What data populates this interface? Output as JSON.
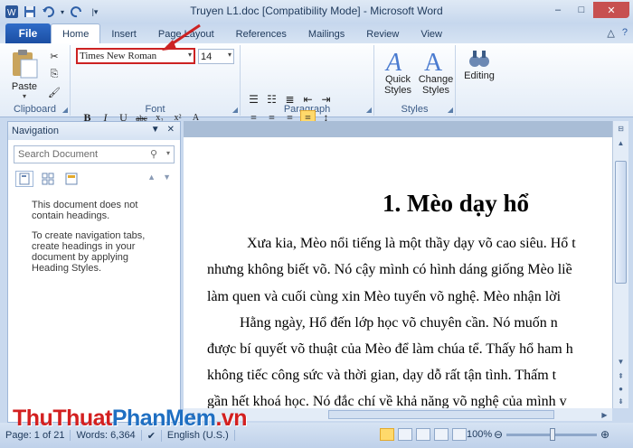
{
  "window": {
    "title": "Truyen L1.doc [Compatibility Mode] - Microsoft Word",
    "controls": {
      "minimize": "–",
      "maximize": "□",
      "close": "✕"
    }
  },
  "tabs": {
    "file": "File",
    "items": [
      "Home",
      "Insert",
      "Page Layout",
      "References",
      "Mailings",
      "Review",
      "View"
    ],
    "active": "Home"
  },
  "ribbon": {
    "clipboard": {
      "paste_label": "Paste",
      "group_label": "Clipboard"
    },
    "font": {
      "font_name": "Times New Roman",
      "font_size": "14",
      "group_label": "Font",
      "bold": "B",
      "italic": "I",
      "underline": "U",
      "strike": "abc",
      "subscript": "x₂",
      "superscript": "x²",
      "grow": "A",
      "shrink": "A",
      "change_case": "Aa",
      "clear": "A"
    },
    "paragraph": {
      "group_label": "Paragraph",
      "show_marks": "¶"
    },
    "styles": {
      "quick_styles": "Quick Styles",
      "change_styles": "Change Styles",
      "group_label": "Styles"
    },
    "editing": {
      "label": "Editing"
    }
  },
  "navigation": {
    "title": "Navigation",
    "search_placeholder": "Search Document",
    "message1": "This document does not contain headings.",
    "message2": "To create navigation tabs, create headings in your document by applying Heading Styles."
  },
  "document": {
    "title": "1. Mèo dạy hổ",
    "lines": [
      "Xưa kia, Mèo nổi tiếng là một thầy dạy võ cao siêu. Hổ t",
      "nhưng không biết võ. Nó cậy mình có hình dáng giống Mèo liề",
      "làm quen và cuối cùng xin Mèo tuyển võ nghệ. Mèo nhận lời",
      "Hằng ngày, Hổ đến lớp học võ chuyên cần. Nó muốn n",
      "được bí quyết võ thuật của Mèo để làm chúa tể. Thấy hổ ham h",
      "không tiếc công sức và thời gian, dạy dỗ rất tận tình. Thấm t",
      "gần hết khoá học. Nó đắc chí về khả năng võ nghệ của mình v"
    ]
  },
  "status": {
    "page": "Page: 1 of 21",
    "words": "Words: 6,364",
    "language": "English (U.S.)",
    "zoom": "100%"
  },
  "watermark": {
    "part1": "ThuThuat",
    "part2": "PhanMem",
    "part3": ".vn"
  },
  "colors": {
    "accent": "#2b579a",
    "annotation": "#cc2222",
    "highlight": "#ffd96b"
  }
}
